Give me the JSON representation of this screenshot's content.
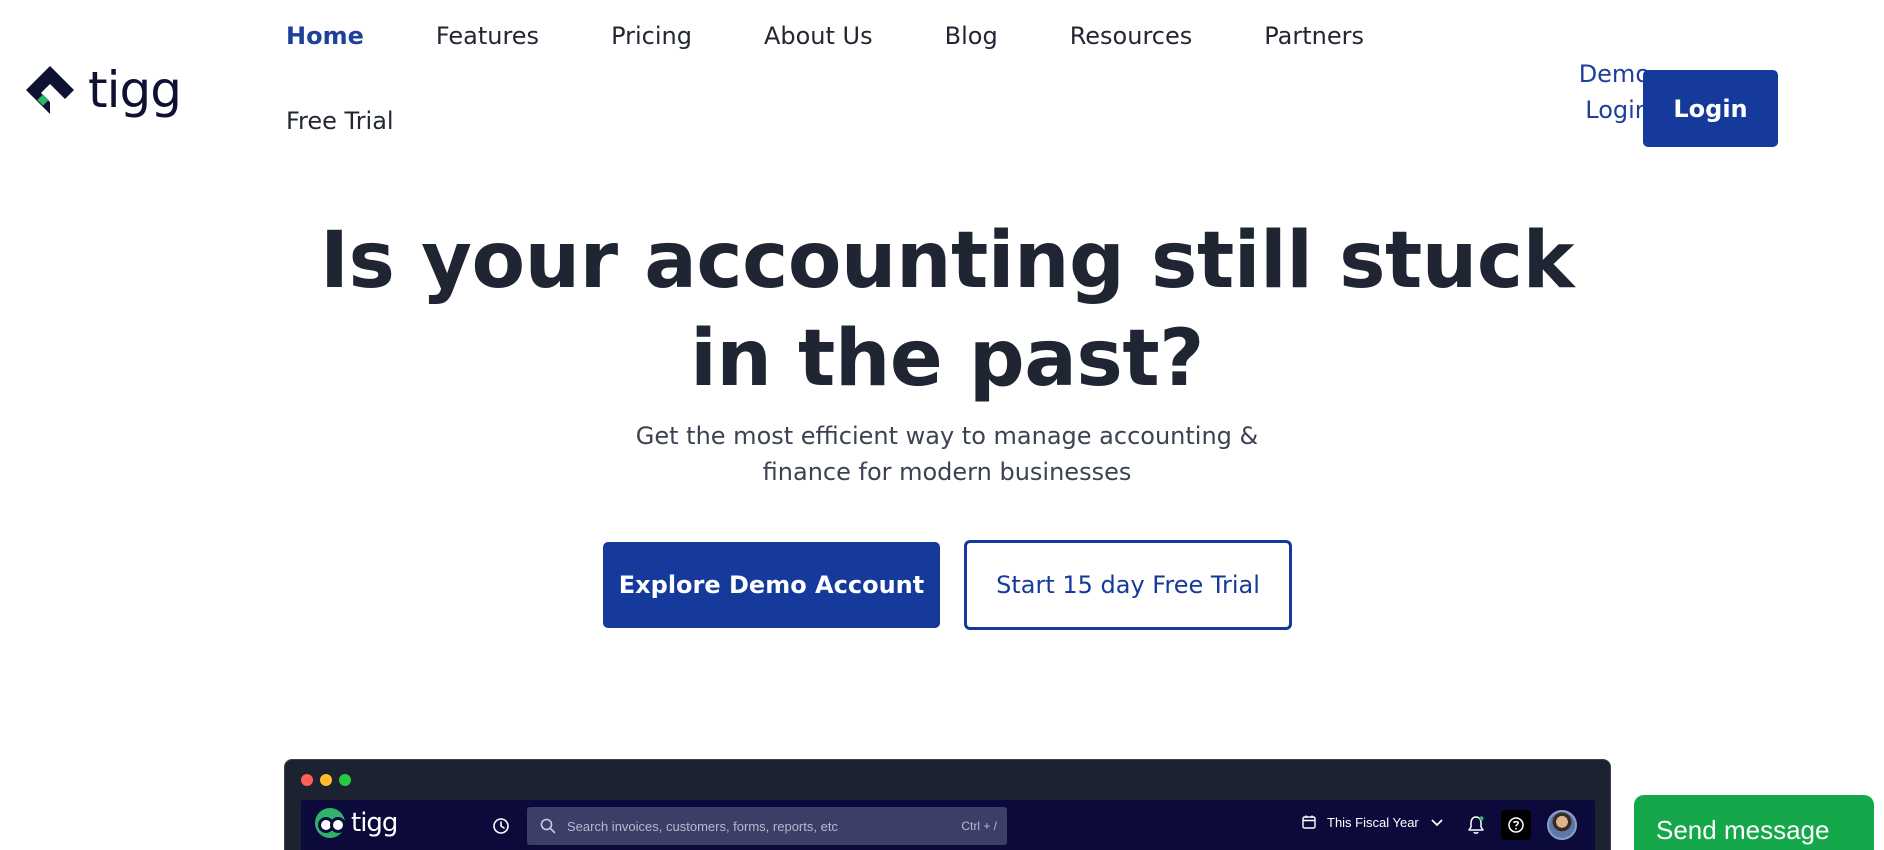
{
  "brand": {
    "name": "tigg"
  },
  "nav": {
    "items": [
      {
        "label": "Home",
        "active": true
      },
      {
        "label": "Features"
      },
      {
        "label": "Pricing"
      },
      {
        "label": "About Us"
      },
      {
        "label": "Blog"
      },
      {
        "label": "Resources"
      },
      {
        "label": "Partners"
      },
      {
        "label": "Free Trial"
      }
    ]
  },
  "header": {
    "demo_login": "Demo Login",
    "login": "Login"
  },
  "hero": {
    "title": "Is your accounting still stuck in the past?",
    "subtitle": "Get the most efficient way to manage accounting & finance for modern businesses",
    "primary_cta": "Explore Demo Account",
    "secondary_cta": "Start 15 day Free Trial"
  },
  "app_preview": {
    "brand": "tigg",
    "search_placeholder": "Search invoices, customers, forms, reports, etc",
    "search_shortcut": "Ctrl + /",
    "period": "This Fiscal Year"
  },
  "chat": {
    "label": "Send message"
  },
  "colors": {
    "primary": "#163a9c",
    "text": "#1f2533",
    "app_bar": "#0c0a3a",
    "chat": "#15a84a"
  }
}
